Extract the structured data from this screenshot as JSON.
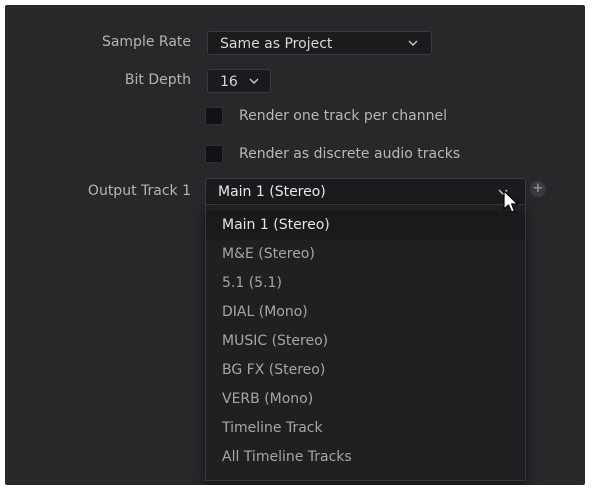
{
  "sample_rate": {
    "label": "Sample Rate",
    "value": "Same as Project"
  },
  "bit_depth": {
    "label": "Bit Depth",
    "value": "16"
  },
  "options": {
    "one_track_per_channel": {
      "label": "Render one track per channel",
      "checked": false
    },
    "discrete_audio_tracks": {
      "label": "Render as discrete audio tracks",
      "checked": false
    }
  },
  "output_track": {
    "label": "Output Track 1",
    "value": "Main 1 (Stereo)",
    "add_icon": "plus-icon",
    "dropdown_items": [
      "Main 1 (Stereo)",
      "M&E (Stereo)",
      "5.1 (5.1)",
      "DIAL (Mono)",
      "MUSIC (Stereo)",
      "BG FX (Stereo)",
      "VERB (Mono)",
      "Timeline Track",
      "All Timeline Tracks"
    ],
    "selected_index": 0
  },
  "colors": {
    "panel_bg": "#28282b",
    "field_bg": "#1b1b1d",
    "text": "#d8d8d8",
    "label": "#b5b5b5"
  }
}
